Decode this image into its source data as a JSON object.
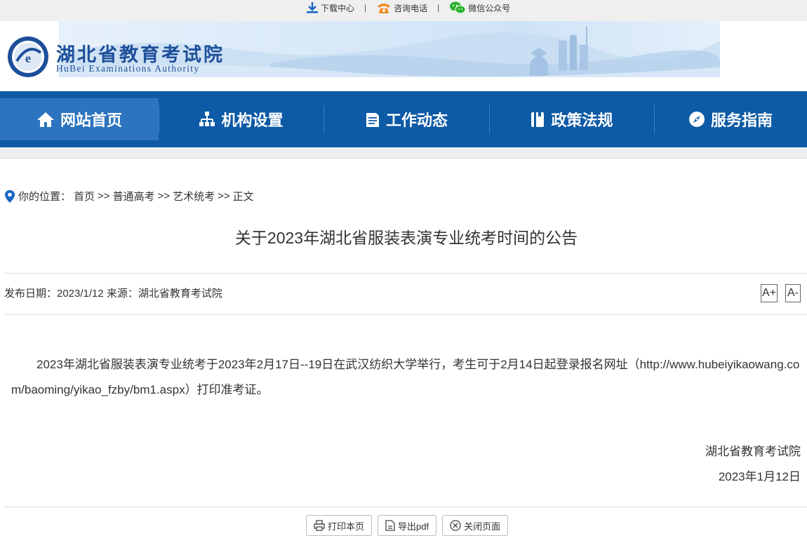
{
  "topbar": {
    "download_label": "下载中心",
    "phone_label": "咨询电话",
    "wechat_label": "微信公众号",
    "separator": "|"
  },
  "header": {
    "site_name_cn": "湖北省教育考试院",
    "site_name_en": "HuBei Examinations Authority"
  },
  "nav": {
    "items": [
      {
        "label": "网站首页",
        "icon": "home-icon"
      },
      {
        "label": "机构设置",
        "icon": "org-chart-icon"
      },
      {
        "label": "工作动态",
        "icon": "document-icon"
      },
      {
        "label": "政策法规",
        "icon": "book-icon"
      },
      {
        "label": "服务指南",
        "icon": "compass-icon"
      }
    ],
    "active_index": 0
  },
  "breadcrumb": {
    "prefix": "你的位置：",
    "items": [
      "首页",
      "普通高考",
      "艺术统考",
      "正文"
    ],
    "separator": ">>"
  },
  "article": {
    "title": "关于2023年湖北省服装表演专业统考时间的公告",
    "meta": "发布日期：2023/1/12 来源：湖北省教育考试院",
    "font_increase": "A+",
    "font_decrease": "A-",
    "body": "2023年湖北省服装表演专业统考于2023年2月17日--19日在武汉纺织大学举行，考生可于2月14日起登录报名网址（http://www.hubeiyikaowang.com/baoming/yikao_fzby/bm1.aspx）打印准考证。",
    "sign_org": "湖北省教育考试院",
    "sign_date": "2023年1月12日"
  },
  "actions": {
    "print_label": "打印本页",
    "pdf_label": "导出pdf",
    "close_label": "关闭页面"
  },
  "colors": {
    "nav_bg": "#0d5aa6",
    "nav_active": "#2c74bf",
    "brand_blue": "#1d4f9a",
    "download_icon": "#1a66c2",
    "phone_icon": "#f08a24",
    "wechat_icon": "#2bb12f",
    "location_icon": "#1a66c2"
  }
}
